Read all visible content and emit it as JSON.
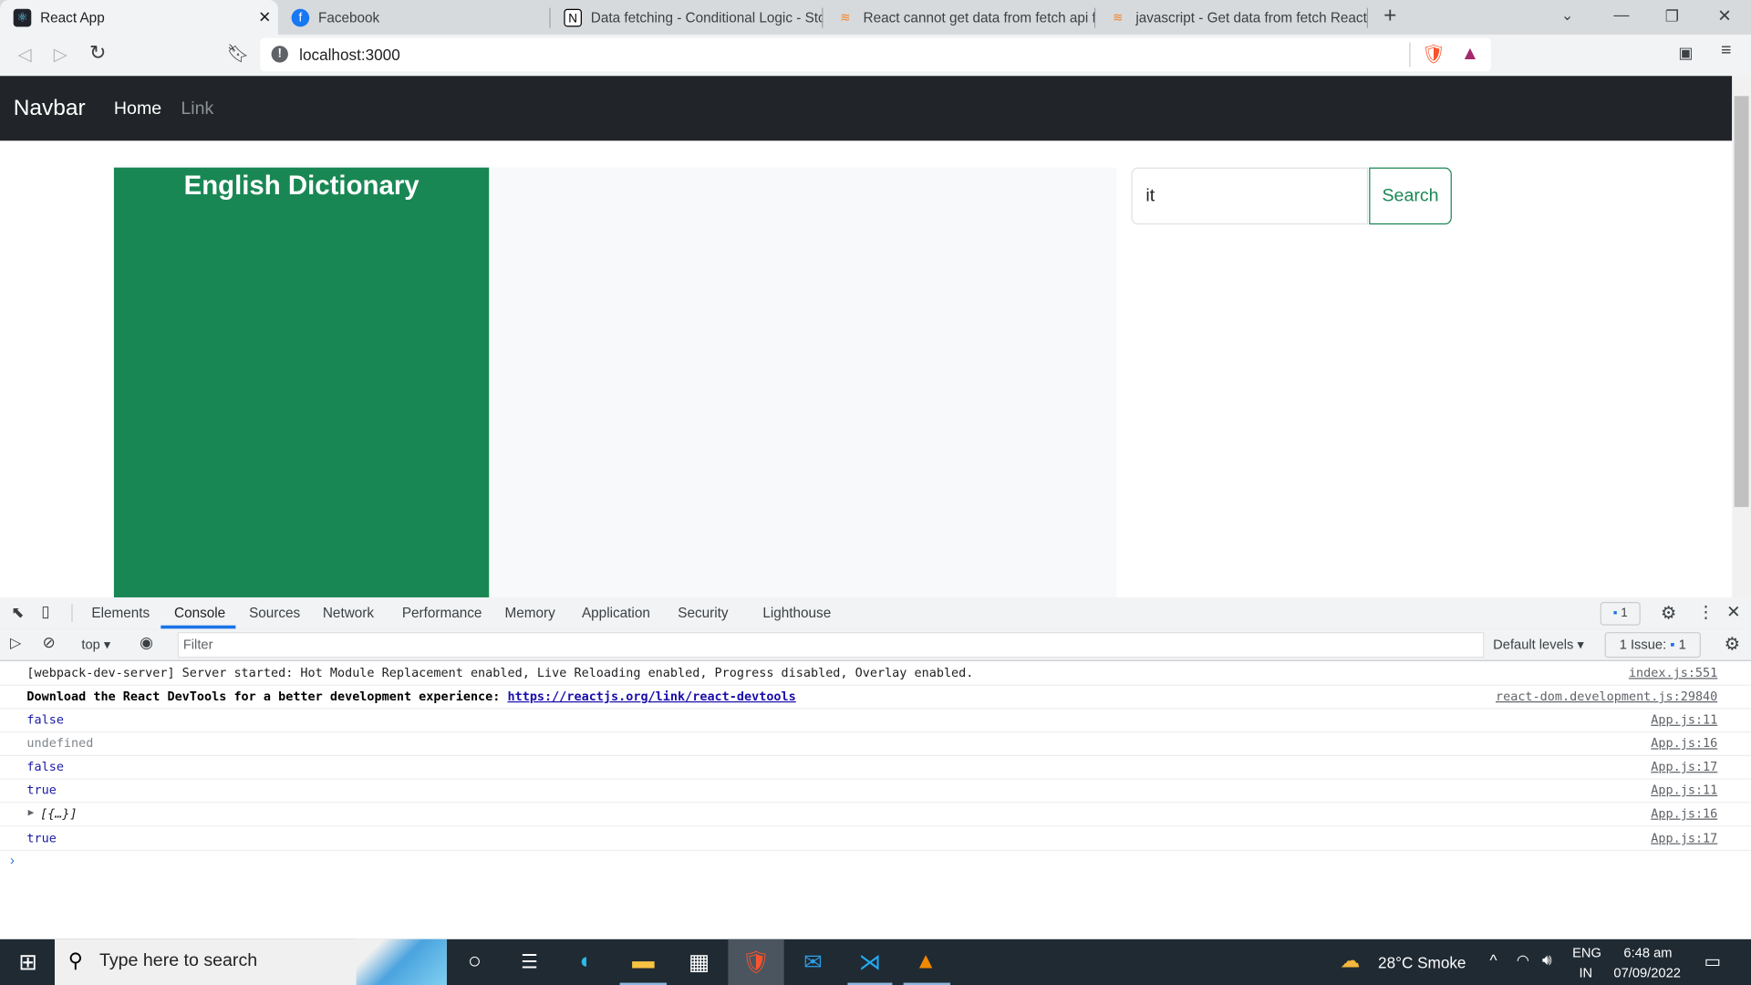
{
  "browser": {
    "tabs": [
      {
        "title": "React App",
        "icon": "react-icon",
        "active": true
      },
      {
        "title": "Facebook",
        "icon": "facebook-icon"
      },
      {
        "title": "Data fetching - Conditional Logic - Sto",
        "icon": "vercel-icon"
      },
      {
        "title": "React cannot get data from fetch api f",
        "icon": "stackoverflow-icon"
      },
      {
        "title": "javascript - Get data from fetch React",
        "icon": "stackoverflow-icon"
      }
    ],
    "new_tab": "+",
    "url": "localhost:3000"
  },
  "page": {
    "navbar": {
      "brand": "Navbar",
      "links": [
        "Home",
        "Link"
      ]
    },
    "title": "English Dictionary",
    "search_value": "it",
    "search_button": "Search",
    "colors": {
      "green": "#198754",
      "navbar": "#212529"
    }
  },
  "devtools": {
    "tabs": [
      "Elements",
      "Console",
      "Sources",
      "Network",
      "Performance",
      "Memory",
      "Application",
      "Security",
      "Lighthouse"
    ],
    "active_tab": "Console",
    "message_badge": "1",
    "context": "top",
    "filter_placeholder": "Filter",
    "levels": "Default levels",
    "issues": "1 Issue:",
    "issues_count": "1",
    "console": [
      {
        "msg": "[webpack-dev-server] Server started: Hot Module Replacement enabled, Live Reloading enabled, Progress disabled, Overlay enabled.",
        "src": "index.js:551",
        "kind": "log"
      },
      {
        "msg": "Download the React DevTools for a better development experience: ",
        "link": "https://reactjs.org/link/react-devtools",
        "src": "react-dom.development.js:29840",
        "kind": "bold"
      },
      {
        "msg": "false",
        "src": "App.js:11",
        "kind": "bool"
      },
      {
        "msg": "undefined",
        "src": "App.js:16",
        "kind": "undef"
      },
      {
        "msg": "false",
        "src": "App.js:17",
        "kind": "bool"
      },
      {
        "msg": "true",
        "src": "App.js:11",
        "kind": "bool"
      },
      {
        "msg": "[{…}]",
        "src": "App.js:16",
        "kind": "obj"
      },
      {
        "msg": "true",
        "src": "App.js:17",
        "kind": "bool"
      }
    ]
  },
  "taskbar": {
    "search_placeholder": "Type here to search",
    "weather": "28°C  Smoke",
    "lang1": "ENG",
    "lang2": "IN",
    "time": "6:48 am",
    "date": "07/09/2022"
  }
}
